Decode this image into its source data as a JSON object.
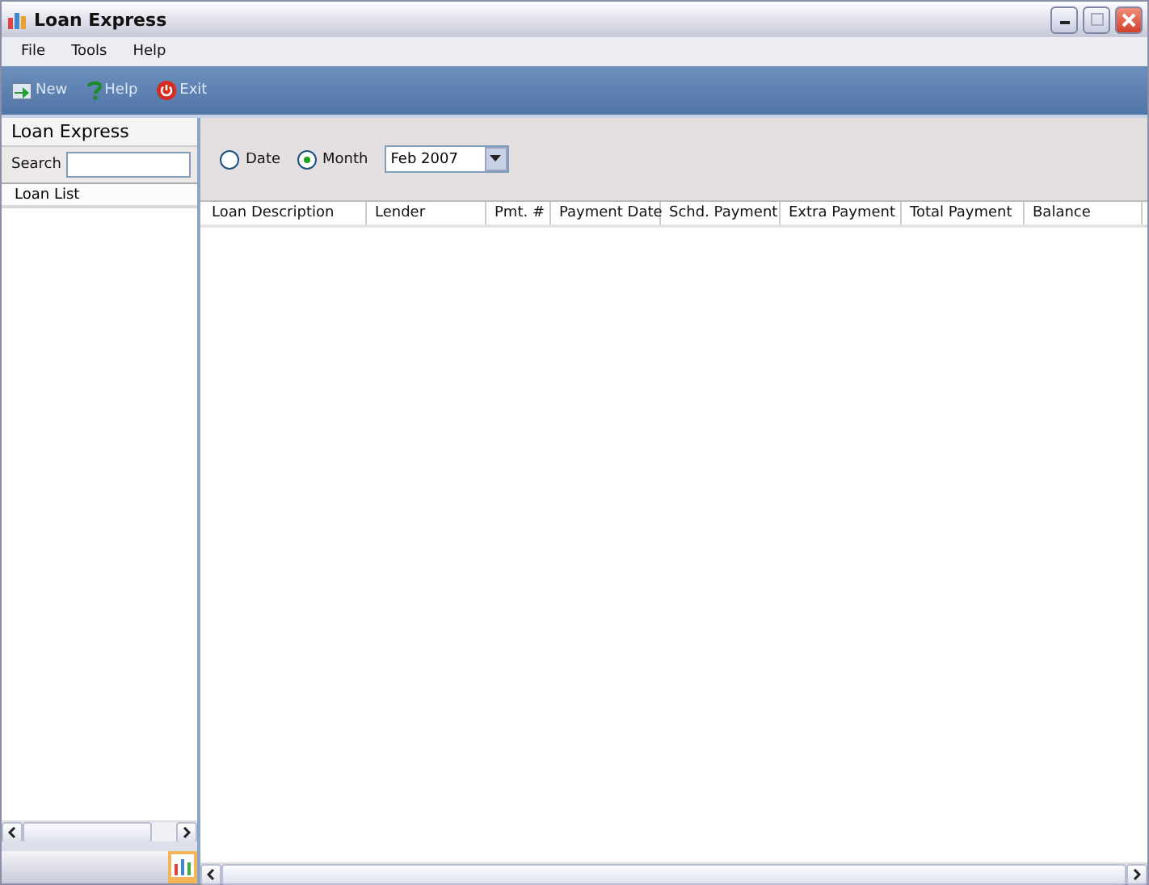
{
  "window": {
    "title": "Loan Express"
  },
  "menu": [
    "File",
    "Tools",
    "Help"
  ],
  "toolbar": [
    {
      "kind": "new",
      "label": "New"
    },
    {
      "kind": "help",
      "label": "Help"
    },
    {
      "kind": "exit",
      "label": "Exit"
    }
  ],
  "sidebar": {
    "title": "Loan Express",
    "search_label": "Search",
    "list_header": "Loan List"
  },
  "filter": {
    "options": [
      {
        "label": "Date",
        "selected": false
      },
      {
        "label": "Month",
        "selected": true
      }
    ],
    "month": "Feb 2007"
  },
  "table": {
    "columns": [
      {
        "label": "Loan Description"
      },
      {
        "label": "Lender"
      },
      {
        "label": "Pmt. #"
      },
      {
        "label": "Payment Date"
      },
      {
        "label": "Schd. Payment"
      },
      {
        "label": "Extra Payment"
      },
      {
        "label": "Total Payment"
      },
      {
        "label": "Balance"
      }
    ]
  }
}
